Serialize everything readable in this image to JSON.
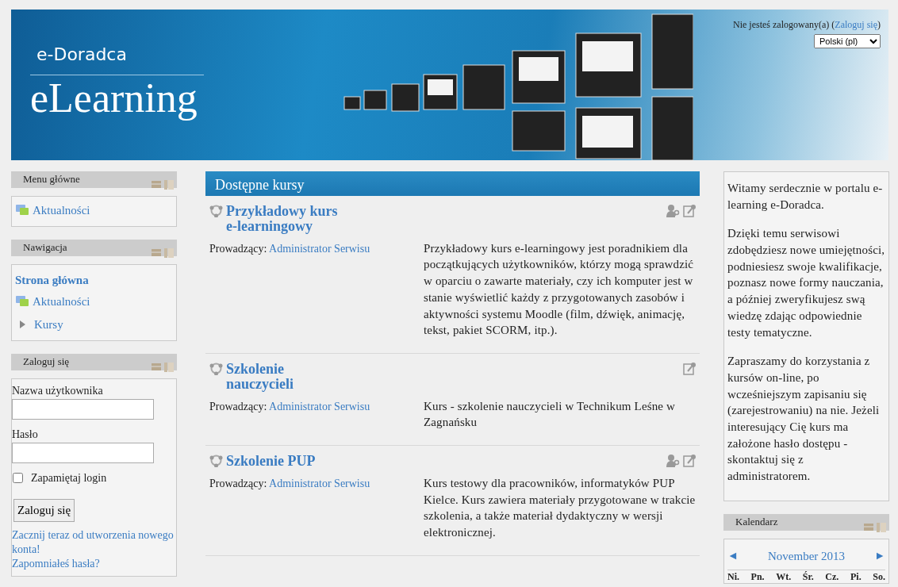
{
  "header": {
    "brand_small": "e-Doradca",
    "brand_large": "eLearning",
    "login_info": "Nie jesteś zalogowany(a)",
    "paren_open": "(",
    "login_link": "Zaloguj się",
    "paren_close": ")",
    "language": "Polski (pl)"
  },
  "left_blocks": [
    {
      "kind": "menu",
      "title": "Menu główne",
      "items": [
        {
          "label": "Aktualności",
          "kind": "forum"
        }
      ]
    },
    {
      "kind": "navigation",
      "title": "Nawigacja",
      "home": "Strona główna",
      "items": [
        {
          "label": "Aktualności",
          "kind": "forum"
        },
        {
          "label": "Kursy",
          "kind": "branch",
          "expanded": false
        }
      ]
    },
    {
      "kind": "login",
      "title": "Zaloguj się",
      "username_label": "Nazwa użytkownika",
      "password_label": "Hasło",
      "remember_label": "Zapamiętaj login",
      "remember_checked": false,
      "submit": "Zaloguj się",
      "links": [
        "Zacznij teraz od utworzenia nowego konta!",
        "Zapomniałeś hasła?"
      ]
    }
  ],
  "main": {
    "title": "Dostępne kursy",
    "courses": [
      {
        "name": "Przykładowy kurs e-learningowy",
        "teacher_label": "Prowadzący:",
        "teacher": "Administrator Serwisu",
        "guest_access": true,
        "enrol_key": true,
        "summary": "Przykładowy kurs e-learningowy jest poradnikiem dla początkujących użytkowników, którzy mogą sprawdzić w oparciu o zawarte materiały, czy ich komputer jest w stanie wyświetlić każdy z przygotowanych zasobów i aktywności systemu Moodle (film, dźwięk, animację, tekst, pakiet SCORM, itp.)."
      },
      {
        "name": "Szkolenie nauczycieli",
        "teacher_label": "Prowadzący:",
        "teacher": "Administrator Serwisu",
        "guest_access": false,
        "enrol_key": true,
        "summary": "Kurs - szkolenie nauczycieli w Technikum Leśne w Zagnańsku"
      },
      {
        "name": "Szkolenie PUP",
        "teacher_label": "Prowadzący:",
        "teacher": "Administrator Serwisu",
        "guest_access": true,
        "enrol_key": true,
        "summary": "Kurs testowy dla pracowników, informatyków PUP Kielce. Kurs zawiera materiały przygotowane w trakcie szkolenia, a także materiał dydaktyczny w wersji elektronicznej."
      }
    ]
  },
  "right_blocks": [
    {
      "kind": "html",
      "paragraphs": [
        "Witamy serdecznie w portalu e-learning e-Doradca.",
        "Dzięki temu serwisowi zdobędziesz nowe umiejętności, podniesiesz swoje kwalifikacje, poznasz nowe formy nauczania, a później zweryfikujesz swą wiedzę zdając odpowiednie testy tematyczne.",
        "Zapraszamy do korzystania z kursów on-line, po wcześniejszym zapisaniu się (zarejestrowaniu) na nie. Jeżeli interesujący Cię kurs ma założone hasło dostępu - skontaktuj się z administratorem."
      ]
    },
    {
      "kind": "calendar",
      "title": "Kalendarz",
      "prev": "◄",
      "month": "November 2013",
      "next": "►",
      "weekdays": [
        "Ni.",
        "Pn.",
        "Wt.",
        "Śr.",
        "Cz.",
        "Pi.",
        "So."
      ]
    }
  ]
}
